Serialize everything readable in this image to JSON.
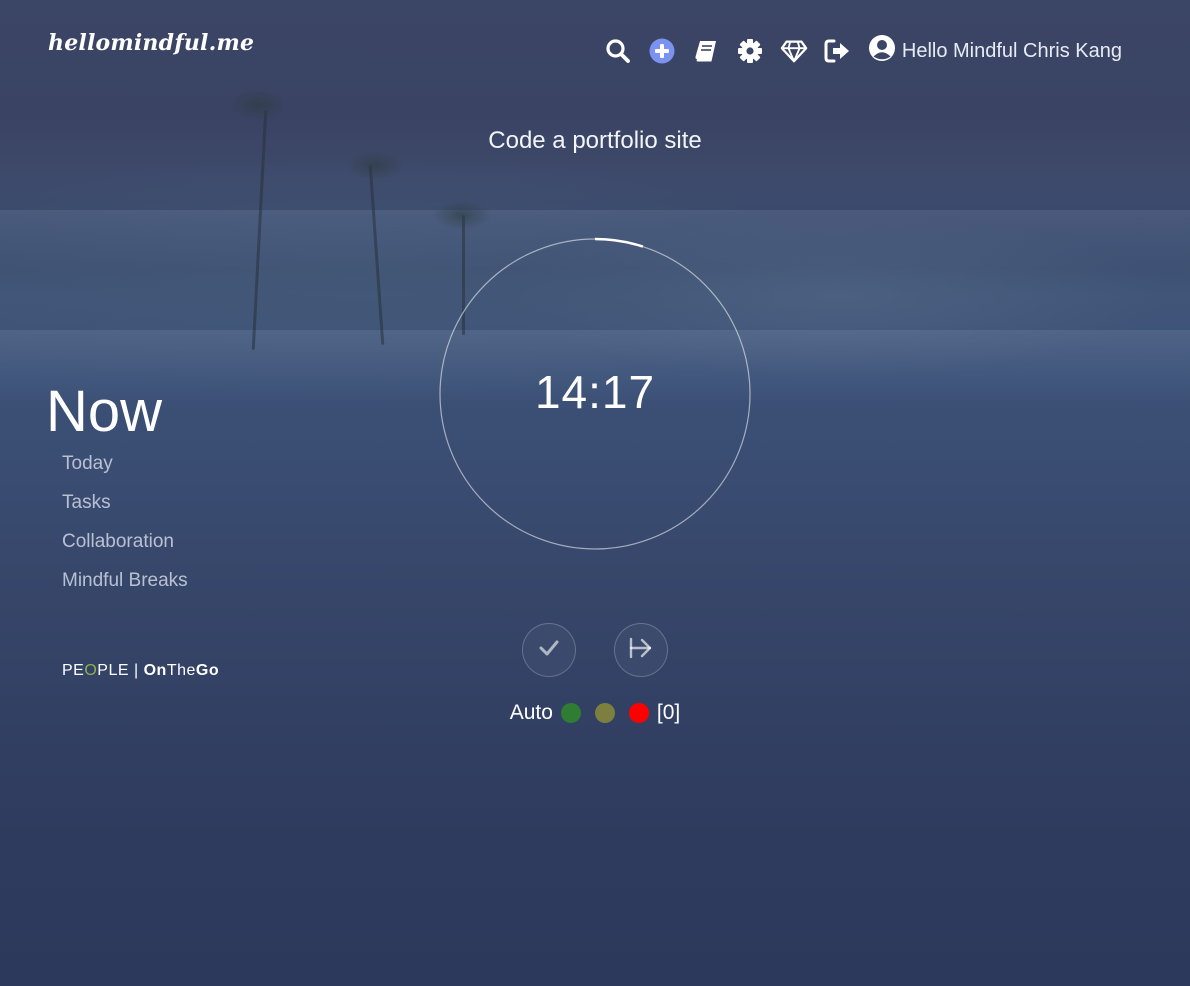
{
  "header": {
    "logo": "hellomindful.me",
    "greeting": "Hello Mindful Chris Kang",
    "icons": [
      "search-icon",
      "add-icon",
      "book-icon",
      "gear-icon",
      "diamond-icon",
      "logout-icon",
      "user-icon"
    ]
  },
  "task": {
    "title": "Code a portfolio site"
  },
  "timer": {
    "time": "14:17",
    "progress": 0.05
  },
  "left_nav": {
    "title": "Now",
    "items": [
      {
        "label": "Today"
      },
      {
        "label": "Tasks"
      },
      {
        "label": "Collaboration"
      },
      {
        "label": "Mindful Breaks"
      }
    ],
    "brand": {
      "pe": "PE",
      "o": "O",
      "ple": "PLE | ",
      "on": "On",
      "the": "The",
      "go": "Go"
    }
  },
  "controls": {
    "auto_label": "Auto",
    "count": "[0]",
    "dots": [
      {
        "color": "#2e7d32",
        "name": "green"
      },
      {
        "color": "#7c7f3e",
        "name": "olive"
      },
      {
        "color": "#ff0000",
        "name": "red"
      }
    ]
  },
  "colors": {
    "accent": "#7b93f0",
    "menu_text": "#b9c0d2"
  }
}
